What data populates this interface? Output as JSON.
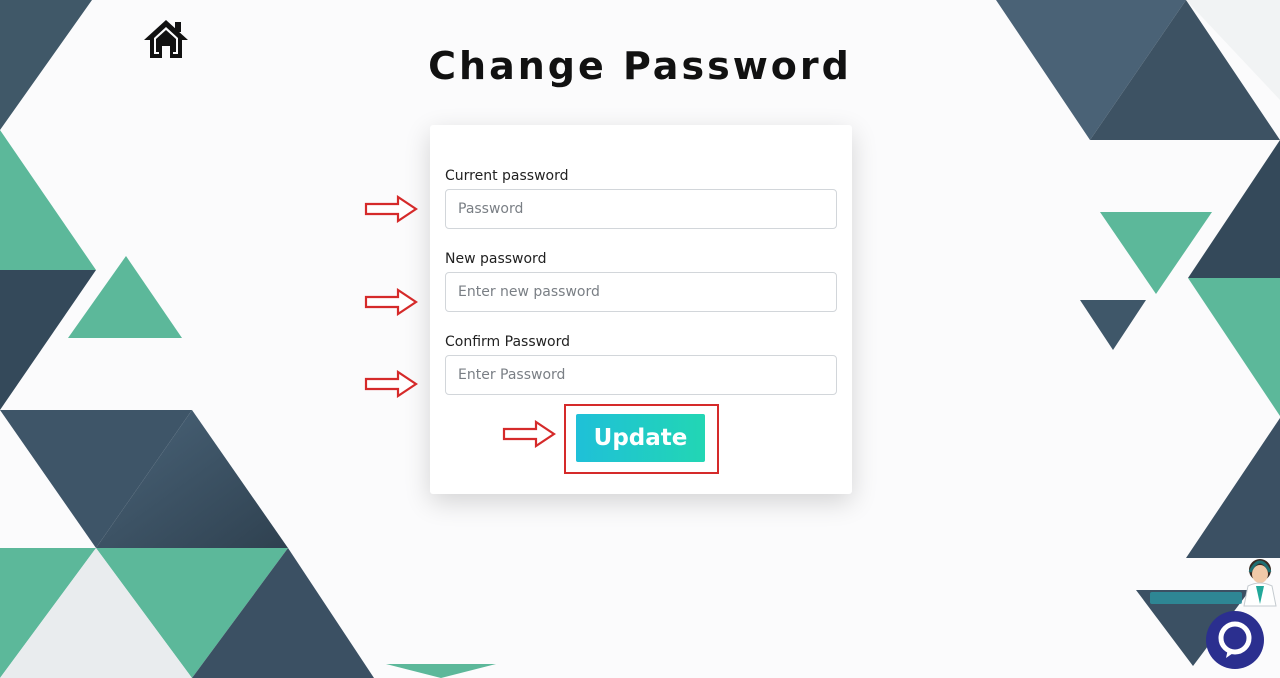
{
  "page": {
    "title": "Change Password"
  },
  "form": {
    "current": {
      "label": "Current password",
      "placeholder": "Password",
      "value": ""
    },
    "new": {
      "label": "New password",
      "placeholder": "Enter new password",
      "value": ""
    },
    "confirm": {
      "label": "Confirm Password",
      "placeholder": "Enter Password",
      "value": ""
    },
    "submit_label": "Update"
  },
  "icons": {
    "home": "home-icon",
    "chat": "chat-bubble-icon",
    "support_agent": "support-agent-icon",
    "arrow": "annotation-arrow-icon"
  },
  "colors": {
    "button_gradient_start": "#1fc0d8",
    "button_gradient_end": "#22d6b4",
    "annotation_red": "#d52a2a",
    "teal": "#5cb89a",
    "slate": "#3f5566",
    "chat_navy": "#2b2f8f"
  }
}
